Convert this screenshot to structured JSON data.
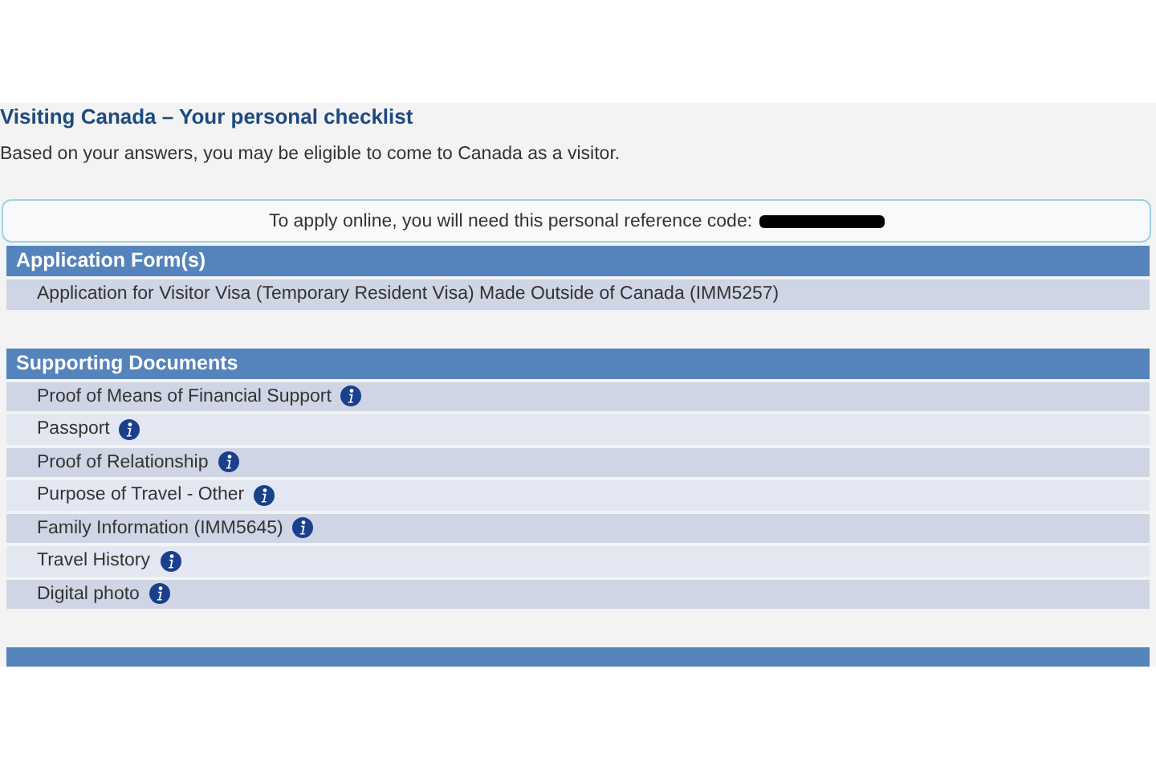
{
  "title": "Visiting Canada – Your personal checklist",
  "intro": "Based on your answers, you may be eligible to come to Canada as a visitor.",
  "reference_notice": {
    "text": "To apply online, you will need this personal reference code:",
    "code_redacted": true
  },
  "sections": [
    {
      "kind": "section",
      "heading": "Application Form(s)",
      "items": [
        {
          "label": "Application for Visitor Visa (Temporary Resident Visa) Made Outside of Canada (IMM5257)",
          "info": false
        }
      ]
    },
    {
      "kind": "section",
      "heading": "Supporting Documents",
      "items": [
        {
          "label": "Proof of Means of Financial Support",
          "info": true
        },
        {
          "label": "Passport",
          "info": true
        },
        {
          "label": "Proof of Relationship",
          "info": true
        },
        {
          "label": "Purpose of Travel - Other",
          "info": true
        },
        {
          "label": "Family Information (IMM5645)",
          "info": true
        },
        {
          "label": "Travel History",
          "info": true
        },
        {
          "label": "Digital photo",
          "info": true
        }
      ]
    },
    {
      "kind": "cut_off_header"
    }
  ]
}
